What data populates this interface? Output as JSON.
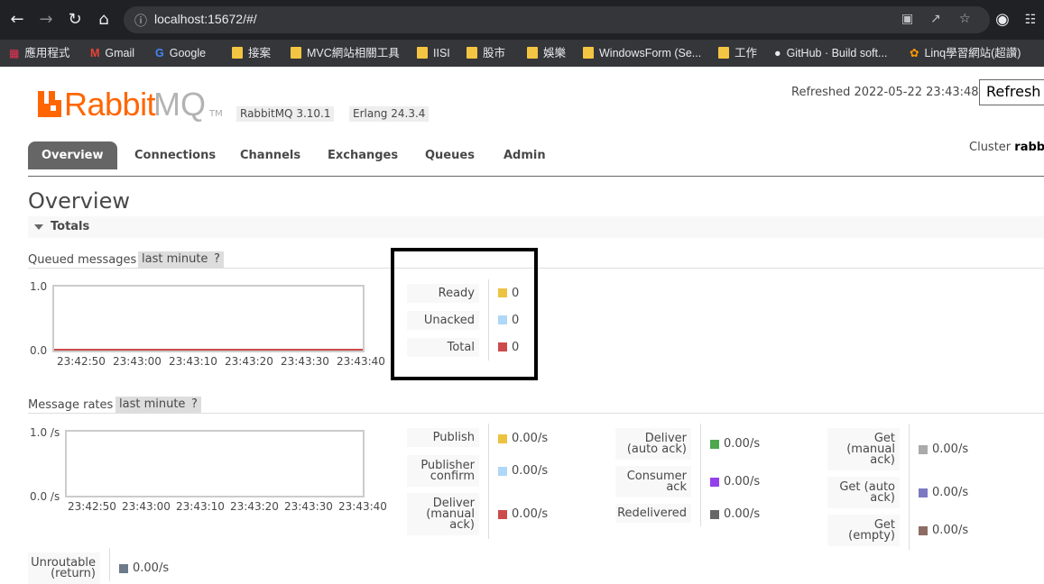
{
  "browser": {
    "url": "localhost:15672/#/",
    "bookmarks": [
      "應用程式",
      "Gmail",
      "Google",
      "接案",
      "MVC網站相關工具",
      "IISI",
      "股市",
      "娛樂",
      "WindowsForm (Se...",
      "工作",
      "GitHub · Build soft...",
      "Linq學習網站(超讚)"
    ]
  },
  "header": {
    "logo_rabbit": "Rabbit",
    "logo_mq": "MQ",
    "logo_tm": "TM",
    "rabbitmq_version": "RabbitMQ 3.10.1",
    "erlang_version": "Erlang 24.3.4",
    "refreshed": "Refreshed 2022-05-22 23:43:48",
    "refresh_button": "Refresh e",
    "cluster_label": "Cluster",
    "cluster_name": "rabbi"
  },
  "tabs": [
    "Overview",
    "Connections",
    "Channels",
    "Exchanges",
    "Queues",
    "Admin"
  ],
  "page_title": "Overview",
  "section": "Totals",
  "queued": {
    "label": "Queued messages",
    "range": "last minute",
    "help": "?",
    "y_top": "1.0",
    "y_bottom": "0.0",
    "x_ticks": [
      "23:42:50",
      "23:43:00",
      "23:43:10",
      "23:43:20",
      "23:43:30",
      "23:43:40"
    ],
    "stats": [
      {
        "label": "Ready",
        "value": "0",
        "color": "#edc240"
      },
      {
        "label": "Unacked",
        "value": "0",
        "color": "#afd8f8"
      },
      {
        "label": "Total",
        "value": "0",
        "color": "#cb4b4b"
      }
    ]
  },
  "rates": {
    "label": "Message rates",
    "range": "last minute",
    "help": "?",
    "y_top": "1.0 /s",
    "y_bottom": "0.0 /s",
    "x_ticks": [
      "23:42:50",
      "23:43:00",
      "23:43:10",
      "23:43:20",
      "23:43:30",
      "23:43:40"
    ],
    "col1": [
      {
        "label": "Publish",
        "value": "0.00/s",
        "color": "#edc240"
      },
      {
        "label": "Publisher confirm",
        "value": "0.00/s",
        "color": "#afd8f8"
      },
      {
        "label": "Deliver (manual ack)",
        "value": "0.00/s",
        "color": "#cb4b4b"
      }
    ],
    "col2": [
      {
        "label": "Deliver (auto ack)",
        "value": "0.00/s",
        "color": "#4da74d"
      },
      {
        "label": "Consumer ack",
        "value": "0.00/s",
        "color": "#9440ed"
      },
      {
        "label": "Redelivered",
        "value": "0.00/s",
        "color": "#666666"
      }
    ],
    "col3": [
      {
        "label": "Get (manual ack)",
        "value": "0.00/s",
        "color": "#aaaaaa"
      },
      {
        "label": "Get (auto ack)",
        "value": "0.00/s",
        "color": "#7c79c3"
      },
      {
        "label": "Get (empty)",
        "value": "0.00/s",
        "color": "#8d6c64"
      }
    ],
    "unroutable": {
      "label": "Unroutable (return)",
      "value": "0.00/s",
      "color": "#6c7a89"
    }
  }
}
